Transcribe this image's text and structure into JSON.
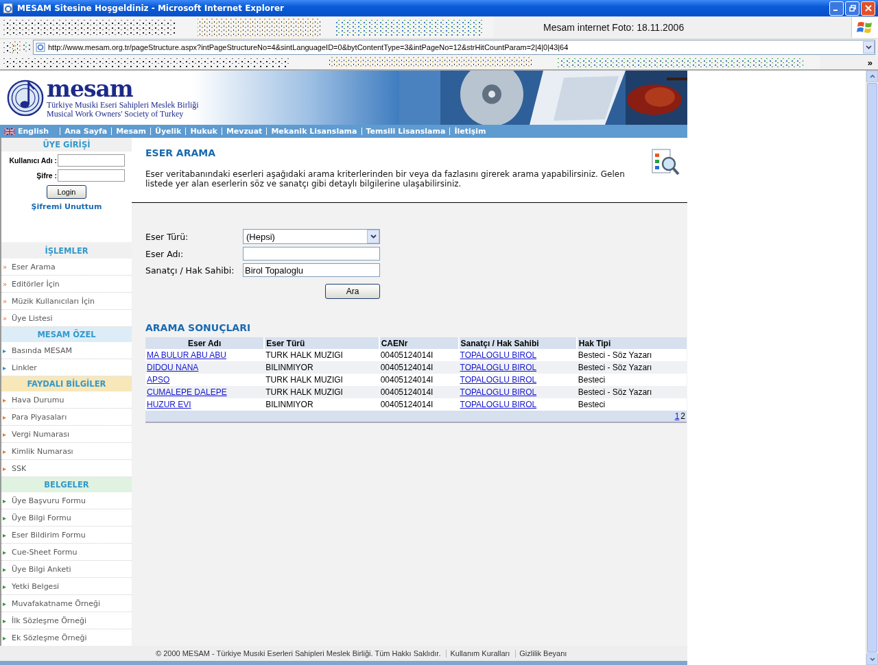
{
  "window": {
    "title": "MESAM Sitesine Hoşgeldiniz - Microsoft Internet Explorer"
  },
  "toolbar": {
    "caption": "Mesam internet Foto: 18.11.2006",
    "overflow": "»"
  },
  "address_bar": {
    "value": "http://www.mesam.org.tr/pageStructure.aspx?intPageStructureNo=4&sintLanguageID=0&bytContentType=3&intPageNo=12&strHitCountParam=2|4|0|43|64"
  },
  "header": {
    "logo": "mesam",
    "subtitle_tr": "Türkiye Musiki Eseri Sahipleri Meslek Birliği",
    "subtitle_en": "Musical Work Owners' Society of Turkey"
  },
  "nav": {
    "language": "English",
    "items": [
      "Ana Sayfa",
      "Mesam",
      "Üyelik",
      "Hukuk",
      "Mevzuat",
      "Mekanik Lisanslama",
      "Temsili Lisanslama",
      "İletişim"
    ]
  },
  "sidebar": {
    "login": {
      "title": "ÜYE GİRİŞİ",
      "username_label": "Kullanıcı Adı :",
      "password_label": "Şifre :",
      "button": "Login",
      "forgot_link": "Şifremi Unuttum"
    },
    "sections": [
      {
        "title": "İŞLEMLER",
        "color": "#f0f0f0",
        "bullet": "»",
        "items": [
          "Eser Arama",
          "Editörler İçin",
          "Müzik Kullanıcıları İçin",
          "Üye Listesi"
        ]
      },
      {
        "title": "MESAM ÖZEL",
        "color": "#dcedf7",
        "bullet": "▸",
        "items": [
          "Basında MESAM",
          "Linkler"
        ]
      },
      {
        "title": "FAYDALI BİLGİLER",
        "color": "#f8e7b8",
        "bullet": "▸",
        "items": [
          "Hava Durumu",
          "Para Piyasaları",
          "Vergi Numarası",
          "Kimlik Numarası",
          "SSK"
        ]
      },
      {
        "title": "BELGELER",
        "color": "#e0f2e0",
        "bullet": "▸",
        "items": [
          "Üye Başvuru Formu",
          "Üye Bilgi Formu",
          "Eser Bildirim Formu",
          "Cue-Sheet Formu",
          "Üye Bilgi Anketi",
          "Yetki Belgesi",
          "Muvafakatname Örneği",
          "İlk Sözleşme Örneği",
          "Ek Sözleşme Örneği"
        ]
      }
    ]
  },
  "content": {
    "title": "ESER ARAMA",
    "description": "Eser veritabanındaki eserleri aşağıdaki arama kriterlerinden bir veya da fazlasını girerek arama yapabilirsiniz. Gelen listede yer alan eserlerin söz ve sanatçı gibi detaylı bilgilerine ulaşabilirsiniz.",
    "form": {
      "fields": [
        {
          "label": "Eser Türü:",
          "kind": "select",
          "value": "(Hepsi)"
        },
        {
          "label": "Eser Adı:",
          "kind": "text"
        },
        {
          "label": "Sanatçı / Hak Sahibi:",
          "kind": "text",
          "value": "Birol Topaloglu"
        }
      ],
      "button": "Ara"
    },
    "results": {
      "title": "ARAMA SONUÇLARI",
      "columns": [
        {
          "label": "Eser Adı",
          "kind": "link"
        },
        {
          "label": "Eser Türü",
          "kind": "text"
        },
        {
          "label": "CAENr",
          "kind": "text"
        },
        {
          "label": "Sanatçı / Hak Sahibi",
          "kind": "link"
        },
        {
          "label": "Hak Tipi",
          "kind": "text"
        }
      ],
      "rows": [
        [
          "MA BULUR ABU ABU",
          "TURK HALK MUZIGI",
          "00405124014I",
          "TOPALOGLU BIROL",
          "Besteci - Söz Yazarı"
        ],
        [
          "DIDOU NANA",
          "BILINMIYOR",
          "00405124014I",
          "TOPALOGLU BIROL",
          "Besteci - Söz Yazarı"
        ],
        [
          "APSO",
          "TURK HALK MUZIGI",
          "00405124014I",
          "TOPALOGLU BIROL",
          "Besteci"
        ],
        [
          "CUMALEPE DALEPE",
          "TURK HALK MUZIGI",
          "00405124014I",
          "TOPALOGLU BIROL",
          "Besteci - Söz Yazarı"
        ],
        [
          "HUZUR EVI",
          "BILINMIYOR",
          "00405124014I",
          "TOPALOGLU BIROL",
          "Besteci"
        ]
      ],
      "pager": [
        {
          "label": "1",
          "selected": false
        },
        {
          "label": "2",
          "selected": true
        }
      ]
    }
  },
  "footer": {
    "copyright": "© 2000 MESAM - Türkiye Musıki Eserleri Sahipleri Meslek Birliği. Tüm Hakkı Saklıdır.",
    "links": [
      "Kullanım Kuralları",
      "Gizlilik Beyanı"
    ]
  }
}
